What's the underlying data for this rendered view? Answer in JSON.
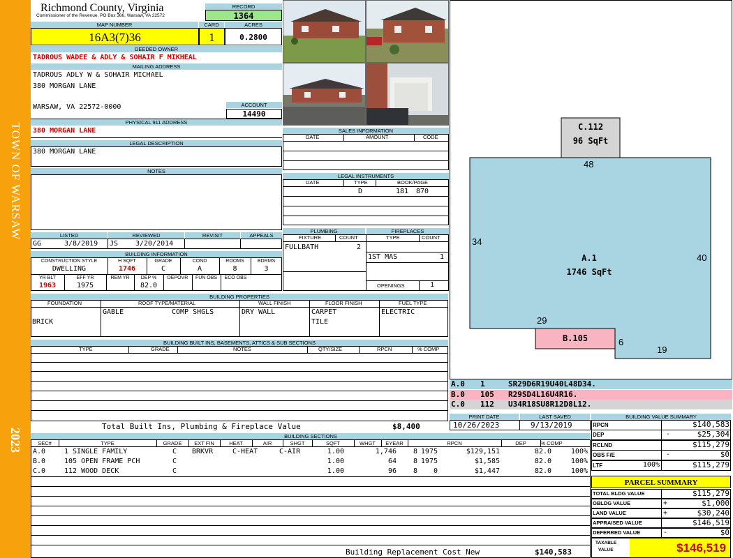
{
  "sidebar": {
    "town": "TOWN OF WARSAW",
    "year": "2023"
  },
  "header": {
    "county": "Richmond County, Virginia",
    "commissioner": "Commissioner of the Revenue, PO Box 366, Warsaw, VA 22572"
  },
  "record": {
    "label": "RECORD",
    "value": "1364"
  },
  "map": {
    "label": "MAP NUMBER",
    "value": "16A3(7)36"
  },
  "card": {
    "label": "CARD",
    "value": "1"
  },
  "acres": {
    "label": "ACRES",
    "value": "0.2800"
  },
  "deeded_owner": {
    "label": "DEEDED OWNER",
    "value": "TADROUS WADEE & ADLY & SOHAIR F MIKHEAL"
  },
  "mailing": {
    "label": "MAILING ADDRESS",
    "line1": "TADROUS ADLY W & SOHAIR MICHAEL",
    "line2": "380 MORGAN LANE",
    "line3": "WARSAW, VA 22572-0000"
  },
  "account": {
    "label": "ACCOUNT",
    "value": "14490"
  },
  "physical": {
    "label": "PHYSICAL 911 ADDRESS",
    "value": "380 MORGAN LANE"
  },
  "legal": {
    "label": "LEGAL DESCRIPTION",
    "value": "380 MORGAN LANE"
  },
  "notes": {
    "label": "NOTES"
  },
  "sales": {
    "label": "SALES INFORMATION",
    "cols": [
      "DATE",
      "AMOUNT",
      "CODE"
    ]
  },
  "instruments": {
    "label": "LEGAL INSTRUMENTS",
    "cols": [
      "DATE",
      "TYPE",
      "BOOK/PAGE"
    ],
    "type": "D",
    "book": "181",
    "page": "870"
  },
  "listed": {
    "label": "LISTED",
    "by": "GG",
    "date": "3/8/2019"
  },
  "reviewed": {
    "label": "REVIEWED",
    "by": "JS",
    "date": "3/20/2014"
  },
  "revisit": {
    "label": "REVISIT"
  },
  "appeals": {
    "label": "APPEALS"
  },
  "plumbing": {
    "label": "PLUMBING",
    "cols": [
      "FIXTURE",
      "COUNT"
    ],
    "fixture": "FULLBATH",
    "count": "2"
  },
  "fireplaces": {
    "label": "FIREPLACES",
    "cols": [
      "TYPE",
      "COUNT"
    ],
    "type": "1ST MAS",
    "count": "1",
    "openings_label": "OPENINGS",
    "openings": "1"
  },
  "bldg_info": {
    "label": "BUILDING INFORMATION",
    "cols1": [
      "CONSTRUCTION STYLE",
      "H SQFT",
      "GRADE",
      "COND",
      "ROOMS",
      "BDRMS"
    ],
    "vals1": [
      "DWELLING",
      "1746",
      "C",
      "A",
      "8",
      "3"
    ],
    "cols2": [
      "YR BLT",
      "EFF YR",
      "REM YR",
      "DEP %",
      "DEPOVR",
      "FUN OBS",
      "ECO OBS"
    ],
    "vals2": [
      "1963",
      "1975",
      "",
      "82.0",
      "",
      "",
      ""
    ]
  },
  "bldg_props": {
    "label": "BUILDING PROPERTIES",
    "cols": [
      "FOUNDATION",
      "ROOF TYPE/MATERIAL",
      "WALL FINISH",
      "FLOOR FINISH",
      "FUEL TYPE"
    ],
    "foundation": "BRICK",
    "roof_type": "GABLE",
    "roof_material": "COMP SHGLS",
    "wall": "DRY WALL",
    "floor1": "CARPET",
    "floor2": "TILE",
    "fuel": "ELECTRIC"
  },
  "builtins": {
    "label": "BUILDING BUILT INS, BASEMENTS, ATTICS & SUB SECTIONS",
    "cols": [
      "TYPE",
      "GRADE",
      "NOTES",
      "QTY/SIZE",
      "RPCN",
      "% COMP"
    ],
    "total_label": "Total Built Ins, Plumbing & Fireplace Value",
    "total_value": "$8,400"
  },
  "sketch": {
    "c_label": "C.112",
    "c_area": "96 SqFt",
    "a_label": "A.1",
    "a_area": "1746 SqFt",
    "b_label": "B.105",
    "dims": [
      "48",
      "34",
      "40",
      "29",
      "6",
      "19"
    ],
    "codes": [
      {
        "sec": "A.0",
        "num": "1",
        "code": "SR29D6R19U40L48D34.",
        "color": "#a9d4e2"
      },
      {
        "sec": "B.0",
        "num": "105",
        "code": "R29SD4L16U4R16.",
        "color": "#f8b4c0"
      },
      {
        "sec": "C.0",
        "num": "112",
        "code": "U34R18SU8R12D8L12.",
        "color": "#d4d4d4"
      }
    ]
  },
  "colors": {
    "header": "#a9d4e2",
    "sidebar": "#f7a10c",
    "record_bg": "#9de68c",
    "yellow": "#ffff00",
    "living": "#a9d4e2",
    "porch": "#f8b4c0",
    "deck": "#d4d4d4"
  },
  "dates": {
    "print_label": "PRINT DATE",
    "print": "10/26/2023",
    "saved_label": "LAST SAVED",
    "saved": "9/13/2019"
  },
  "sections": {
    "label": "BUILDING SECTIONS",
    "cols": [
      "SEC#",
      "TYPE",
      "GRADE",
      "EXT FIN",
      "HEAT",
      "AIR",
      "SHGT",
      "SQFT",
      "WHGT",
      "EYEAR",
      "RPCN",
      "DEP",
      "% COMP"
    ],
    "rows": [
      [
        "A.0",
        "1 SINGLE FAMILY",
        "C",
        "BRKVR",
        "C-HEAT",
        "C-AIR",
        "1.00",
        "1,746",
        "8",
        "1975",
        "$129,151",
        "82.0",
        "100%"
      ],
      [
        "B.0",
        "105 OPEN FRAME PCH",
        "C",
        "",
        "",
        "",
        "1.00",
        "64",
        "8",
        "1975",
        "$1,585",
        "82.0",
        "100%"
      ],
      [
        "C.0",
        "112 WOOD DECK",
        "C",
        "",
        "",
        "",
        "1.00",
        "96",
        "8",
        "0",
        "$1,447",
        "82.0",
        "100%"
      ]
    ],
    "brc_label": "Building Replacement Cost New",
    "brc_value": "$140,583"
  },
  "bvs": {
    "label": "BUILDING VALUE SUMMARY",
    "rows": [
      {
        "k": "RPCN",
        "s": "",
        "v": "$140,583"
      },
      {
        "k": "DEP",
        "s": "-",
        "v": "$25,304"
      },
      {
        "k": "RCLND",
        "s": "",
        "v": "$115,279"
      },
      {
        "k": "OBS F/E",
        "s": "-",
        "v": "$0"
      },
      {
        "k": "LTF",
        "s": "100%",
        "v": "$115,279"
      }
    ]
  },
  "parcel": {
    "title": "PARCEL SUMMARY",
    "rows": [
      {
        "k": "TOTAL BLDG VALUE",
        "s": "",
        "v": "$115,279"
      },
      {
        "k": "OBLDG VALUE",
        "s": "+",
        "v": "$1,000"
      },
      {
        "k": "LAND VALUE",
        "s": "+",
        "v": "$30,240"
      },
      {
        "k": "APPRAISED VALUE",
        "s": "",
        "v": "$146,519"
      },
      {
        "k": "DEFERRED VALUE",
        "s": "-",
        "v": "$0"
      }
    ],
    "taxable_l1": "TAXABLE",
    "taxable_l2": "VALUE",
    "taxable": "$146,519"
  }
}
